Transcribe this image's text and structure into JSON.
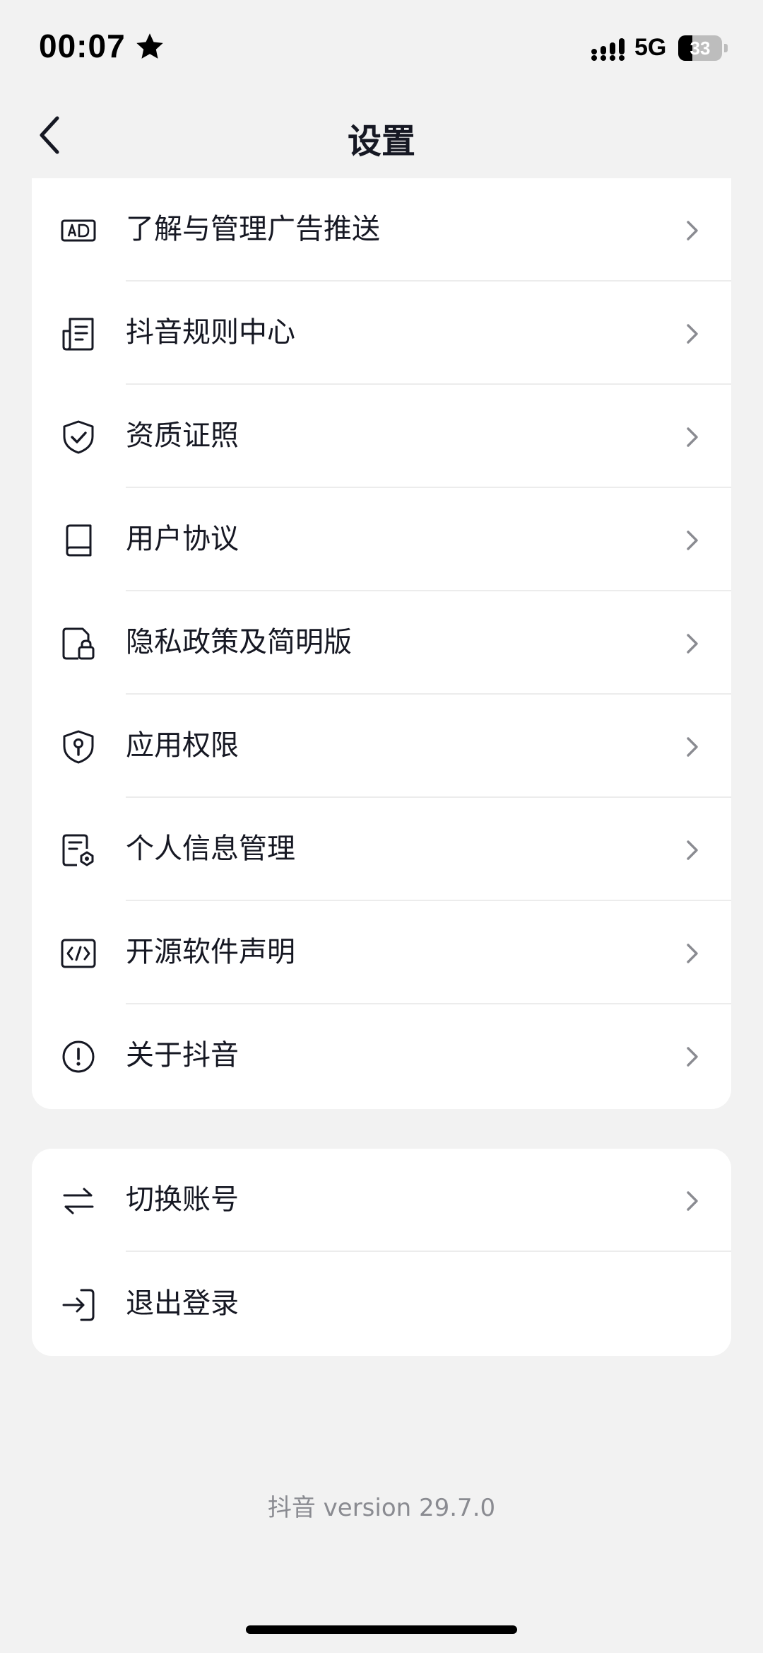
{
  "status_bar": {
    "time": "00:07",
    "network": "5G",
    "battery_level": "33",
    "battery_fraction": 0.33
  },
  "nav": {
    "title": "设置"
  },
  "settings": {
    "items": [
      {
        "label": "了解与管理广告推送",
        "icon": "ad-icon"
      },
      {
        "label": "抖音规则中心",
        "icon": "document-list-icon"
      },
      {
        "label": "资质证照",
        "icon": "shield-check-icon"
      },
      {
        "label": "用户协议",
        "icon": "book-icon"
      },
      {
        "label": "隐私政策及简明版",
        "icon": "file-lock-icon"
      },
      {
        "label": "应用权限",
        "icon": "shield-key-icon"
      },
      {
        "label": "个人信息管理",
        "icon": "file-settings-icon"
      },
      {
        "label": "开源软件声明",
        "icon": "code-icon"
      },
      {
        "label": "关于抖音",
        "icon": "info-circle-icon"
      }
    ]
  },
  "account": {
    "switch_label": "切换账号",
    "logout_label": "退出登录"
  },
  "footer": {
    "version": "抖音 version 29.7.0"
  },
  "colors": {
    "background": "#f2f2f2",
    "card": "#ffffff",
    "text": "#161823",
    "secondary_text": "#8a8b91",
    "chevron": "#8a8b91"
  }
}
